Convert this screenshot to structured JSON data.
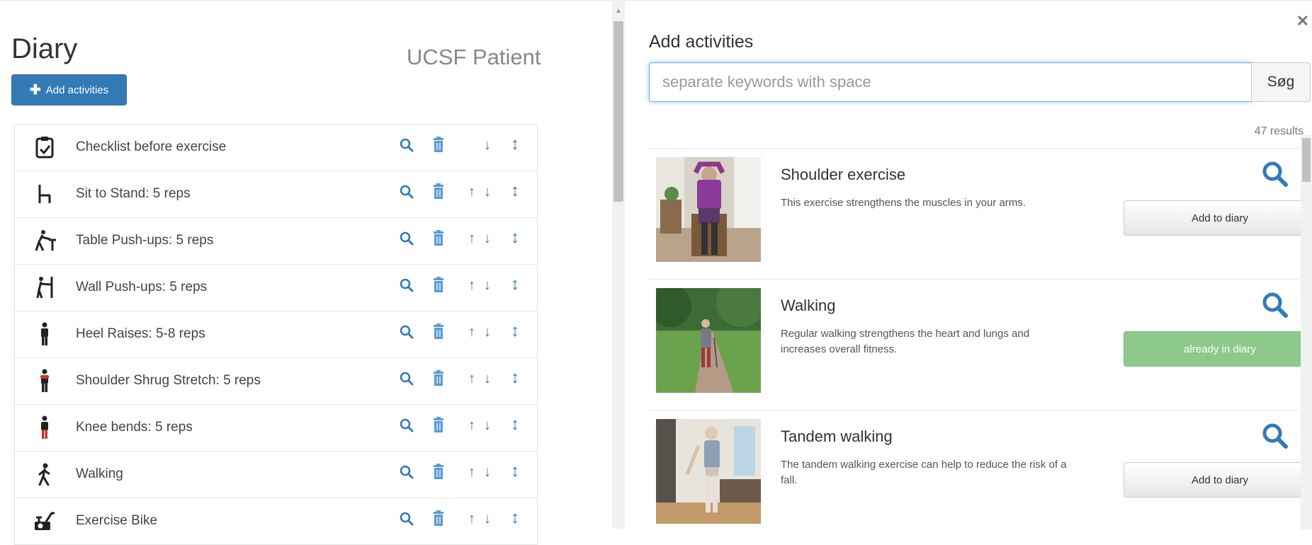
{
  "diary": {
    "title": "Diary",
    "patient": "UCSF Patient",
    "add_button": "Add activities",
    "items": [
      {
        "label": "Checklist before exercise",
        "icon": "clipboard-icon",
        "up": "",
        "down": "↓"
      },
      {
        "label": "Sit to Stand: 5 reps",
        "icon": "chair-icon",
        "up": "↑",
        "down": "↓"
      },
      {
        "label": "Table Push-ups: 5 reps",
        "icon": "table-pushup-icon",
        "up": "↑",
        "down": "↓"
      },
      {
        "label": "Wall Push-ups: 5 reps",
        "icon": "wall-pushup-icon",
        "up": "↑",
        "down": "↓"
      },
      {
        "label": "Heel Raises: 5-8 reps",
        "icon": "person-icon",
        "up": "↑",
        "down": "↓"
      },
      {
        "label": "Shoulder Shrug Stretch: 5 reps",
        "icon": "person-shoulder-icon",
        "up": "↑",
        "down": "↓"
      },
      {
        "label": "Knee bends: 5 reps",
        "icon": "person-legs-icon",
        "up": "↑",
        "down": "↓"
      },
      {
        "label": "Walking",
        "icon": "walking-icon",
        "up": "↑",
        "down": "↓"
      },
      {
        "label": "Exercise Bike",
        "icon": "bike-icon",
        "up": "↑",
        "down": "↓"
      }
    ]
  },
  "modal": {
    "title": "Add activities",
    "search_placeholder": "separate keywords with space",
    "search_value": "",
    "search_button": "Søg",
    "results_count": "47 results",
    "results": [
      {
        "title": "Shoulder exercise",
        "description": "This exercise strengthens the muscles in your arms.",
        "action": "Add to diary",
        "state": "add"
      },
      {
        "title": "Walking",
        "description": "Regular walking strengthens the heart and lungs and increases overall fitness.",
        "action": "already in diary",
        "state": "in"
      },
      {
        "title": "Tandem walking",
        "description": "The tandem walking exercise can help to reduce the risk of a fall.",
        "action": "Add to diary",
        "state": "add"
      }
    ]
  },
  "colors": {
    "primary": "#337ab7",
    "success_muted": "#8cc98a"
  }
}
